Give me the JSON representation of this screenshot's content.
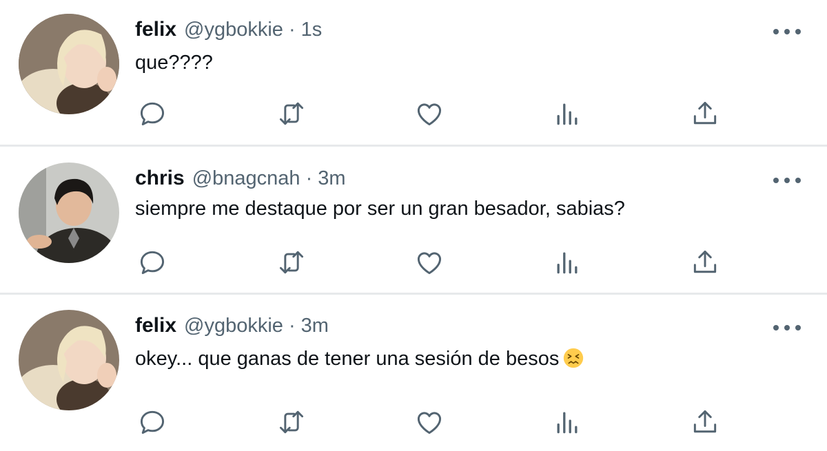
{
  "tweets": [
    {
      "name": "felix",
      "handle": "@ygbokkie",
      "separator": "·",
      "time": "1s",
      "text": "que????",
      "emoji": null,
      "avatar": "felix-avatar"
    },
    {
      "name": "chris",
      "handle": "@bnagcnah",
      "separator": "·",
      "time": "3m",
      "text": "siempre me destaque por ser un gran besador, sabias?",
      "emoji": null,
      "avatar": "chris-avatar"
    },
    {
      "name": "felix",
      "handle": "@ygbokkie",
      "separator": "·",
      "time": "3m",
      "text": "okey... que ganas de tener una sesión de besos",
      "emoji": "confounded-face-emoji",
      "avatar": "felix-avatar"
    }
  ],
  "icons": {
    "reply": "reply-icon",
    "retweet": "retweet-icon",
    "like": "heart-icon",
    "views": "views-icon",
    "share": "share-icon",
    "more": "more-icon"
  },
  "colors": {
    "text": "#0f1419",
    "secondary": "#536471",
    "divider": "#e7e9eb"
  }
}
